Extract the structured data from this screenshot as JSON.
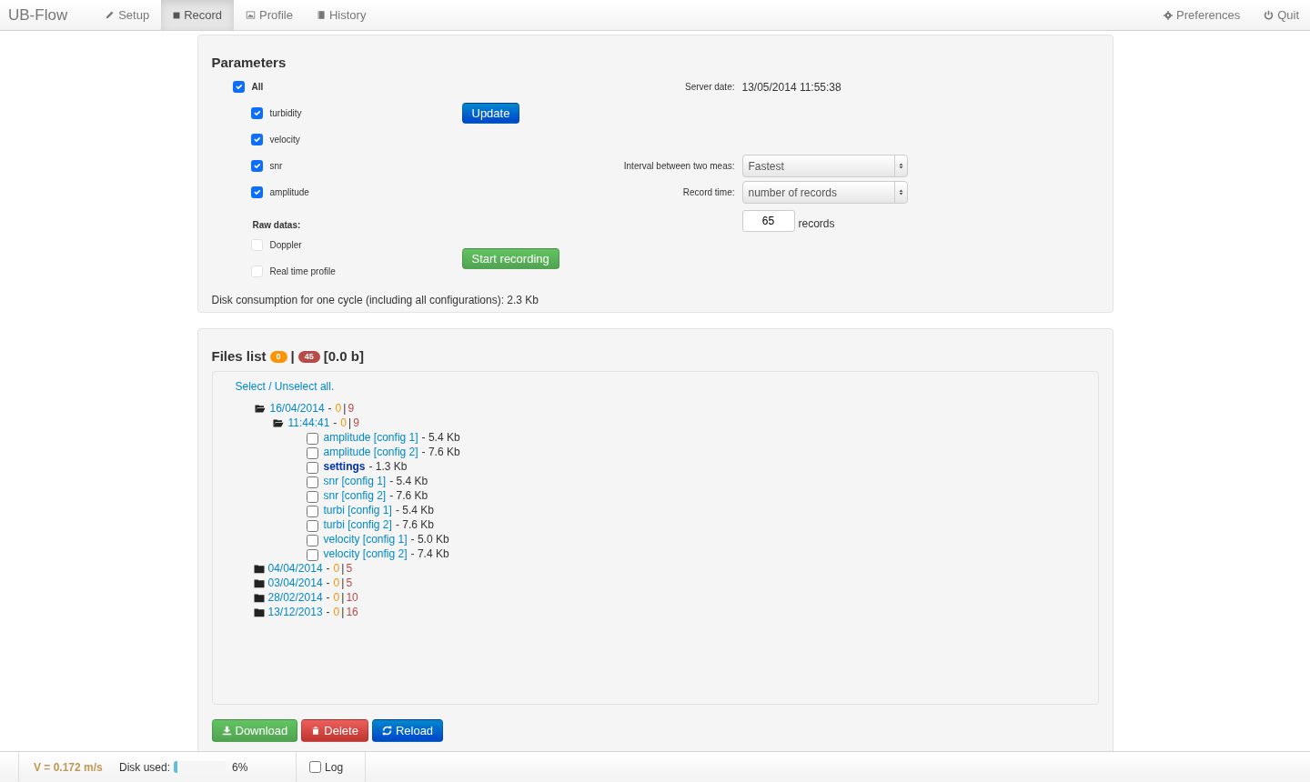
{
  "navbar": {
    "brand": "UB-Flow",
    "items": [
      {
        "label": "Setup",
        "selected": false
      },
      {
        "label": "Record",
        "selected": true
      },
      {
        "label": "Profile",
        "selected": false
      },
      {
        "label": "History",
        "selected": false
      }
    ],
    "right_items": [
      {
        "label": "Preferences"
      },
      {
        "label": "Quit"
      }
    ]
  },
  "parameters": {
    "title": "Parameters",
    "all": {
      "label": "All",
      "checked": true
    },
    "measures": [
      {
        "label": "turbidity",
        "checked": true
      },
      {
        "label": "velocity",
        "checked": true
      },
      {
        "label": "snr",
        "checked": true
      },
      {
        "label": "amplitude",
        "checked": true
      }
    ],
    "raw_label": "Raw datas:",
    "raw": [
      {
        "label": "Doppler",
        "checked": false
      },
      {
        "label": "Real time profile",
        "checked": false
      }
    ],
    "update_button": "Update",
    "start_button": "Start recording",
    "server_date_label": "Server date:",
    "server_date": "13/05/2014 11:55:38",
    "interval": {
      "label": "Interval between two meas:",
      "value": "Fastest"
    },
    "record_time": {
      "label": "Record time:",
      "value": "number of records"
    },
    "records": {
      "value": "65",
      "unit": "records"
    },
    "disk_consumption": "Disk consumption for one cycle (including all configurations): 2.3 Kb"
  },
  "files": {
    "title": "Files list",
    "selected_badge": "0",
    "divider": "|",
    "total_badge": "45",
    "size": "[0.0 b]",
    "select_all": "Select / Unselect all.",
    "tree": [
      {
        "kind": "folder",
        "label": "16/04/2014",
        "sep": "-",
        "selected_count": "0",
        "bar": "|",
        "total_count": "9",
        "expanded": true,
        "children": [
          {
            "kind": "folder",
            "label": "11:44:41",
            "sep": "-",
            "selected_count": "0",
            "bar": "|",
            "total_count": "9",
            "expanded": true,
            "children": [
              {
                "kind": "file",
                "name": "amplitude [config 1]",
                "size": "- 5.4 Kb",
                "checked": false,
                "emphasized": false
              },
              {
                "kind": "file",
                "name": "amplitude [config 2]",
                "size": "- 7.6 Kb",
                "checked": false,
                "emphasized": false
              },
              {
                "kind": "file",
                "name": "settings",
                "size": "- 1.3 Kb",
                "checked": false,
                "emphasized": true
              },
              {
                "kind": "file",
                "name": "snr [config 1]",
                "size": "- 5.4 Kb",
                "checked": false,
                "emphasized": false
              },
              {
                "kind": "file",
                "name": "snr [config 2]",
                "size": "- 7.6 Kb",
                "checked": false,
                "emphasized": false
              },
              {
                "kind": "file",
                "name": "turbi [config 1]",
                "size": "- 5.4 Kb",
                "checked": false,
                "emphasized": false
              },
              {
                "kind": "file",
                "name": "turbi [config 2]",
                "size": "- 7.6 Kb",
                "checked": false,
                "emphasized": false
              },
              {
                "kind": "file",
                "name": "velocity [config 1]",
                "size": "- 5.0 Kb",
                "checked": false,
                "emphasized": false
              },
              {
                "kind": "file",
                "name": "velocity [config 2]",
                "size": "- 7.4 Kb",
                "checked": false,
                "emphasized": false
              }
            ]
          }
        ]
      },
      {
        "kind": "folder",
        "label": "04/04/2014",
        "sep": "-",
        "selected_count": "0",
        "bar": "|",
        "total_count": "5",
        "expanded": false
      },
      {
        "kind": "folder",
        "label": "03/04/2014",
        "sep": "-",
        "selected_count": "0",
        "bar": "|",
        "total_count": "5",
        "expanded": false
      },
      {
        "kind": "folder",
        "label": "28/02/2014",
        "sep": "-",
        "selected_count": "0",
        "bar": "|",
        "total_count": "10",
        "expanded": false
      },
      {
        "kind": "folder",
        "label": "13/12/2013",
        "sep": "-",
        "selected_count": "0",
        "bar": "|",
        "total_count": "16",
        "expanded": false
      }
    ],
    "buttons": [
      {
        "label": "Download",
        "kind": "success"
      },
      {
        "label": "Delete",
        "kind": "danger"
      },
      {
        "label": "Reload",
        "kind": "primary"
      }
    ]
  },
  "status_bar": {
    "velocity": "V = 0.172 m/s",
    "disk_label": "Disk used:",
    "level": 0.06,
    "disk_percent": "6%",
    "log": {
      "label": "Log",
      "checked": false
    }
  }
}
